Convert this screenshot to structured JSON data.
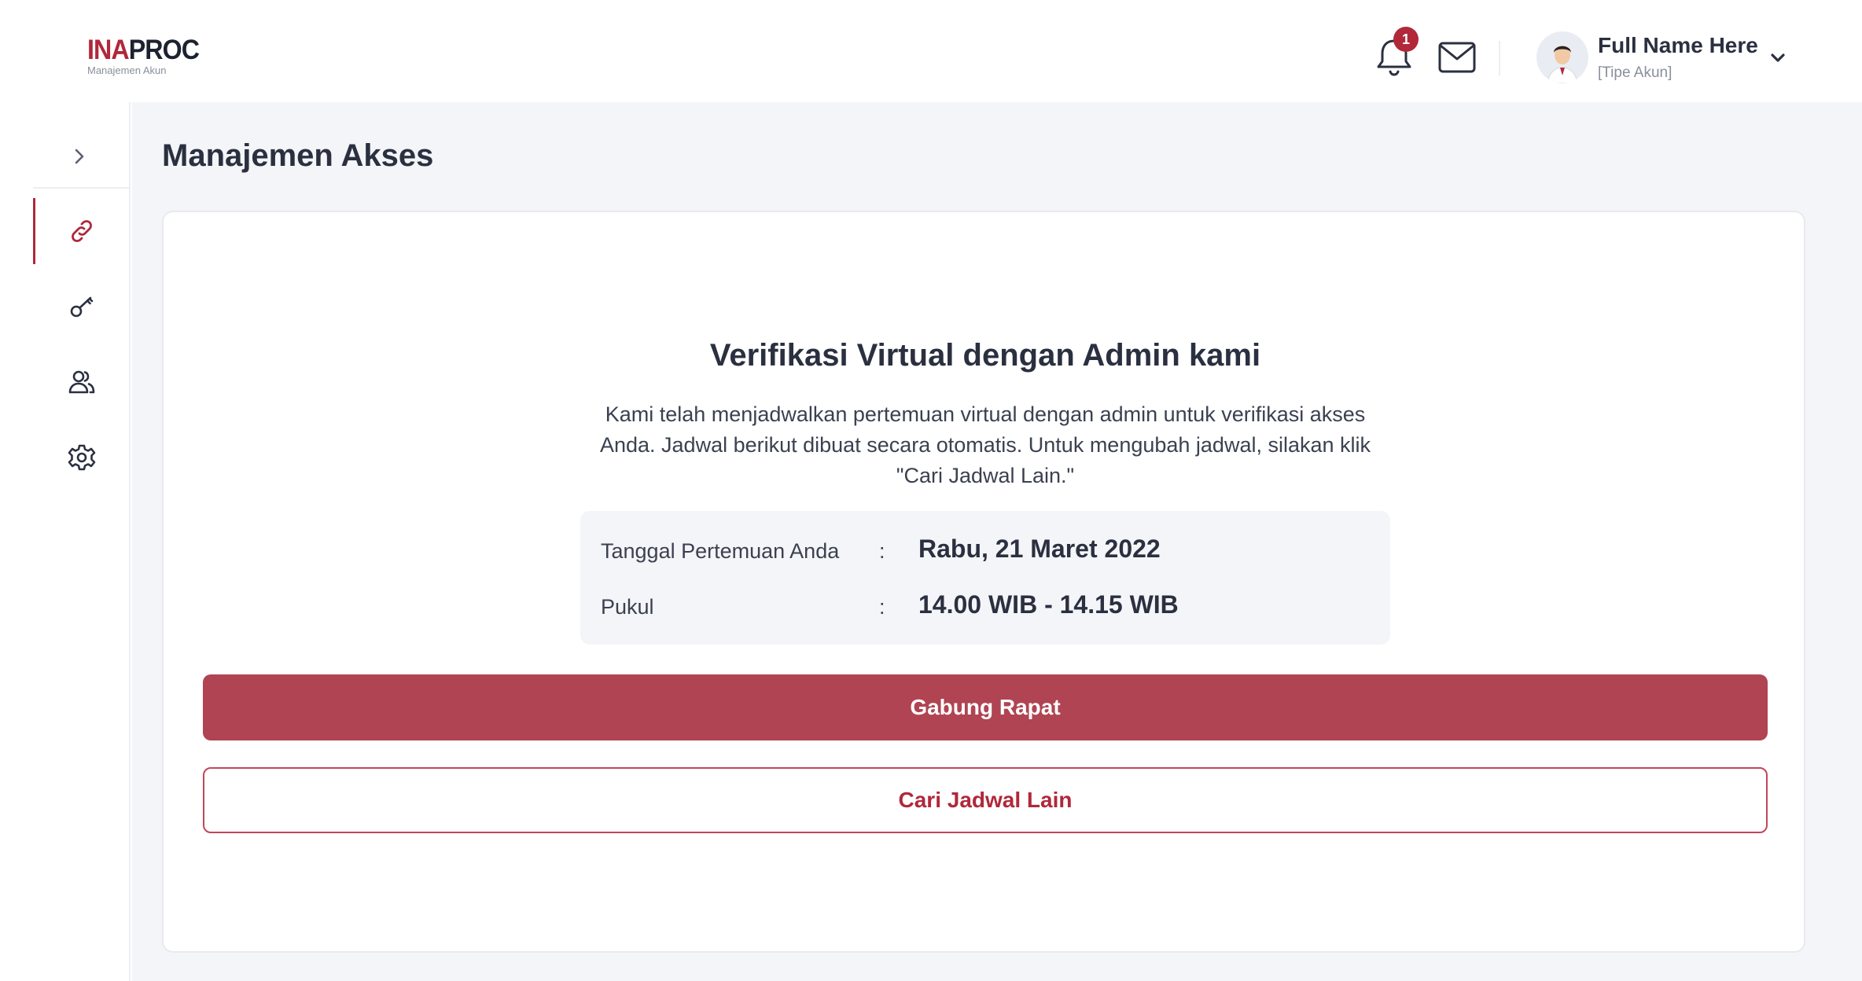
{
  "header": {
    "logo": {
      "brand_prefix": "INA",
      "brand_suffix": "PROC",
      "subtitle": "Manajemen Akun"
    },
    "notifications": {
      "icon": "bell-icon",
      "count": "1"
    },
    "messages": {
      "icon": "mail-icon"
    },
    "user": {
      "name": "Full Name Here",
      "type": "[Tipe Akun]"
    }
  },
  "sidebar": {
    "items": [
      {
        "icon": "link-icon",
        "active": true
      },
      {
        "icon": "key-icon",
        "active": false
      },
      {
        "icon": "users-icon",
        "active": false
      },
      {
        "icon": "gear-icon",
        "active": false
      }
    ]
  },
  "main": {
    "page_title": "Manajemen Akses",
    "card": {
      "title": "Verifikasi Virtual dengan Admin kami",
      "description": "Kami telah menjadwalkan pertemuan virtual dengan admin untuk verifikasi akses Anda. Jadwal berikut dibuat secara otomatis. Untuk mengubah jadwal, silakan klik \"Cari Jadwal Lain.\"",
      "meeting": {
        "date_label": "Tanggal Pertemuan Anda",
        "date_value": "Rabu, 21 Maret 2022",
        "time_label": "Pukul",
        "time_value": "14.00 WIB - 14.15 WIB",
        "separator": ":"
      },
      "join_button": "Gabung Rapat",
      "reschedule_button": "Cari Jadwal Lain"
    }
  },
  "colors": {
    "accent": "#b0283a",
    "primary_button": "#b04452",
    "background": "#f4f5f8"
  }
}
